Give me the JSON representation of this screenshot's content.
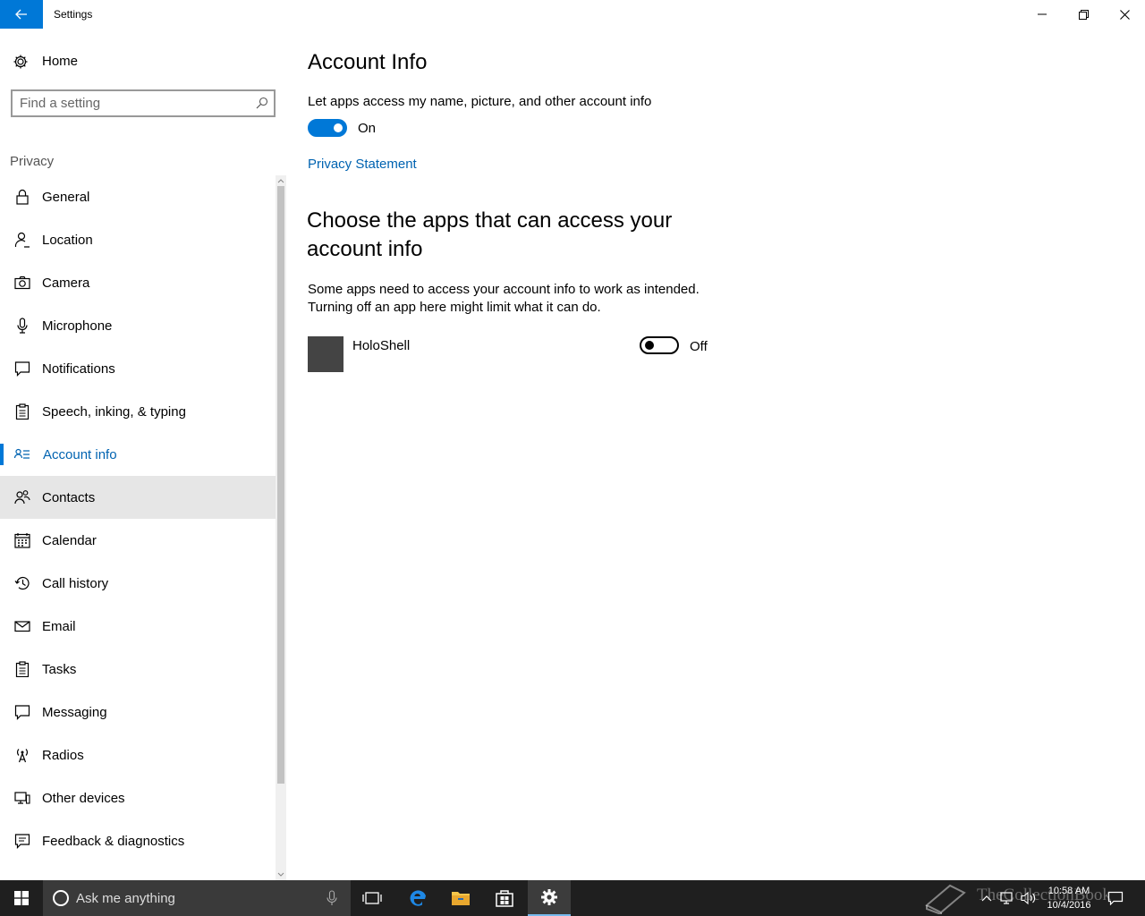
{
  "window": {
    "title": "Settings",
    "back_icon": "arrow-left-icon",
    "controls": [
      "minimize-icon",
      "restore-icon",
      "close-icon"
    ]
  },
  "sidebar": {
    "home_label": "Home",
    "search_placeholder": "Find a setting",
    "section_label": "Privacy",
    "items": [
      {
        "label": "General",
        "icon": "lock-icon"
      },
      {
        "label": "Location",
        "icon": "person-location-icon"
      },
      {
        "label": "Camera",
        "icon": "camera-icon"
      },
      {
        "label": "Microphone",
        "icon": "microphone-icon"
      },
      {
        "label": "Notifications",
        "icon": "notification-icon"
      },
      {
        "label": "Speech, inking, & typing",
        "icon": "clipboard-icon"
      },
      {
        "label": "Account info",
        "icon": "account-card-icon",
        "selected": true
      },
      {
        "label": "Contacts",
        "icon": "contacts-icon",
        "hover": true
      },
      {
        "label": "Calendar",
        "icon": "calendar-icon"
      },
      {
        "label": "Call history",
        "icon": "history-icon"
      },
      {
        "label": "Email",
        "icon": "email-icon"
      },
      {
        "label": "Tasks",
        "icon": "tasks-icon"
      },
      {
        "label": "Messaging",
        "icon": "message-icon"
      },
      {
        "label": "Radios",
        "icon": "radio-tower-icon"
      },
      {
        "label": "Other devices",
        "icon": "devices-icon"
      },
      {
        "label": "Feedback & diagnostics",
        "icon": "feedback-icon"
      }
    ]
  },
  "main": {
    "title": "Account Info",
    "toggle_desc": "Let apps access my name, picture, and other account info",
    "toggle_state": "On",
    "privacy_link": "Privacy Statement",
    "section_title": "Choose the apps that can access your account info",
    "section_desc_line1": "Some apps need to access your account info to work as intended.",
    "section_desc_line2": "Turning off an app here might limit what it can do.",
    "apps": [
      {
        "name": "HoloShell",
        "state": "Off"
      }
    ]
  },
  "taskbar": {
    "search_text": "Ask me anything",
    "time": "10:58 AM",
    "date": "10/4/2016",
    "watermark": "TheCollectionBook",
    "accent_color": "#0078d7"
  }
}
